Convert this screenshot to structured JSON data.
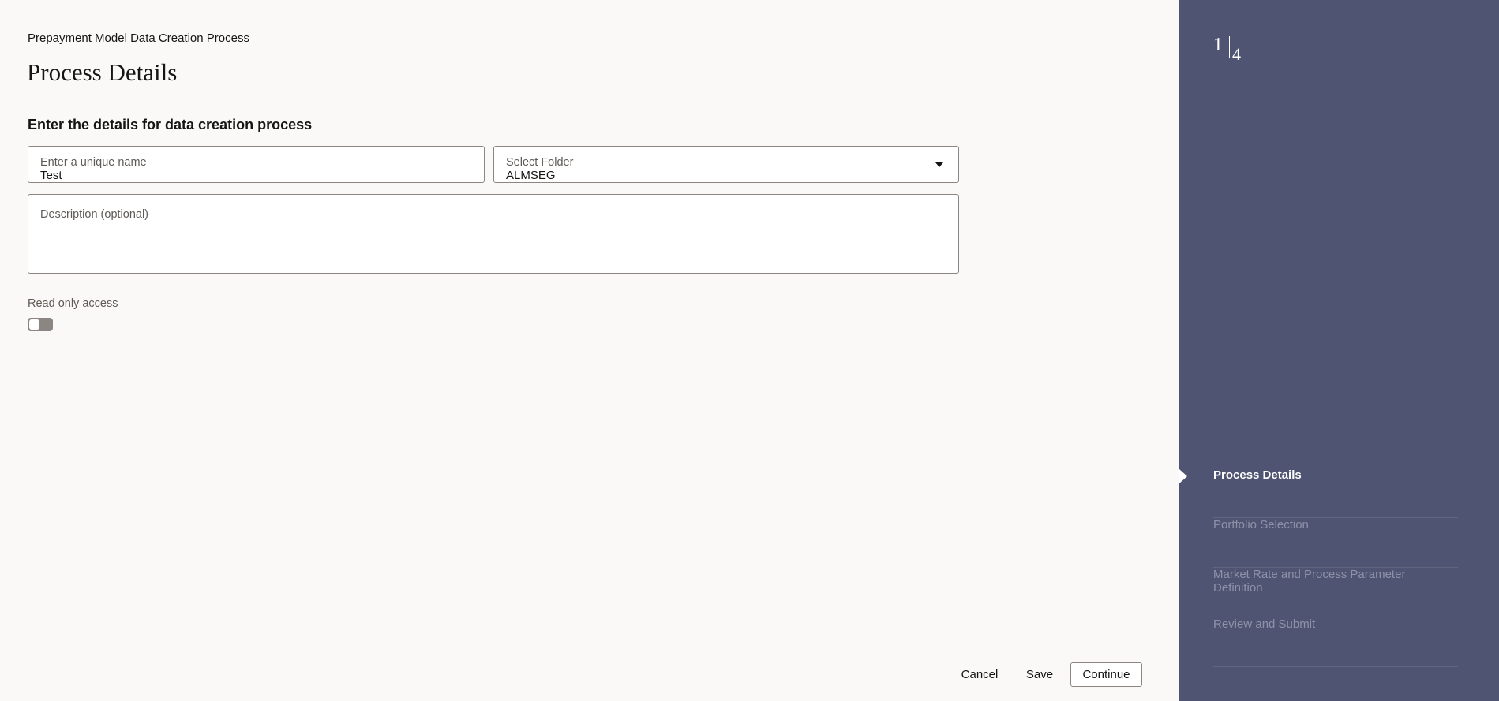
{
  "main": {
    "breadcrumb": "Prepayment Model Data Creation Process",
    "title": "Process Details",
    "section_title": "Enter the details for data creation process",
    "name_field": {
      "label": "Enter a unique name",
      "value": "Test"
    },
    "folder_field": {
      "label": "Select Folder",
      "value": "ALMSEG"
    },
    "description_field": {
      "label": "Description (optional)",
      "value": ""
    },
    "read_only": {
      "label": "Read only access",
      "enabled": false
    }
  },
  "footer": {
    "cancel_label": "Cancel",
    "save_label": "Save",
    "continue_label": "Continue"
  },
  "sidebar": {
    "current_step": "1",
    "total_steps": "4",
    "steps": [
      {
        "label": "Process Details",
        "state": "active"
      },
      {
        "label": "Portfolio Selection",
        "state": "pending"
      },
      {
        "label": "Market Rate and Process Parameter Definition",
        "state": "pending"
      },
      {
        "label": "Review and Submit",
        "state": "pending"
      }
    ]
  },
  "colors": {
    "sidebar_bg": "#4f5472",
    "main_bg": "#faf9f7",
    "text": "#161513",
    "pending_step": "#8e92a8"
  }
}
